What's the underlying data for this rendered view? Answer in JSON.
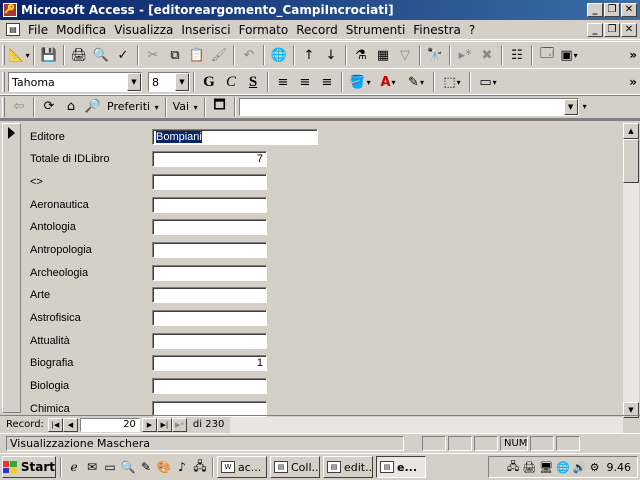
{
  "window": {
    "title": "Microsoft Access - [editoreargomento_CampiIncrociati]"
  },
  "menu": [
    "File",
    "Modifica",
    "Visualizza",
    "Inserisci",
    "Formato",
    "Record",
    "Strumenti",
    "Finestra",
    "?"
  ],
  "format_toolbar": {
    "font": "Tahoma",
    "size": "8",
    "bold": "G",
    "italic": "C",
    "underline": "S"
  },
  "web_toolbar": {
    "favorites": "Preferiti",
    "go": "Vai",
    "address": ""
  },
  "form": {
    "fields": [
      {
        "label": "Editore",
        "value": "Bompiani"
      },
      {
        "label": "Totale di IDLibro",
        "value": "7"
      },
      {
        "label": "<>",
        "value": ""
      },
      {
        "label": "Aeronautica",
        "value": ""
      },
      {
        "label": "Antologia",
        "value": ""
      },
      {
        "label": "Antropologia",
        "value": ""
      },
      {
        "label": "Archeologia",
        "value": ""
      },
      {
        "label": "Arte",
        "value": ""
      },
      {
        "label": "Astrofisica",
        "value": ""
      },
      {
        "label": "Attualità",
        "value": ""
      },
      {
        "label": "Biografia",
        "value": "1"
      },
      {
        "label": "Biologia",
        "value": ""
      },
      {
        "label": "Chimica",
        "value": ""
      }
    ]
  },
  "navigation": {
    "label": "Record:",
    "current": "20",
    "total": "di 230"
  },
  "status": {
    "text": "Visualizzazione Maschera",
    "num": "NUM"
  },
  "taskbar": {
    "start": "Start",
    "tasks": [
      {
        "label": "ac...",
        "active": false
      },
      {
        "label": "Coll...",
        "active": false
      },
      {
        "label": "edit...",
        "active": false
      },
      {
        "label": "e...",
        "active": true
      }
    ],
    "clock": "9.46"
  }
}
